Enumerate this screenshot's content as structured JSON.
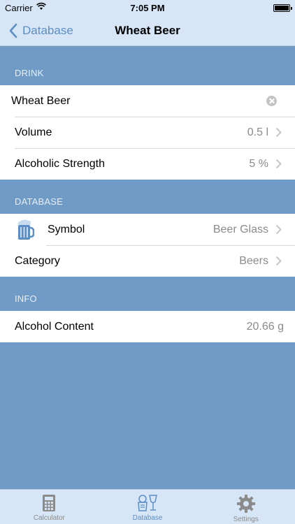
{
  "status_bar": {
    "carrier": "Carrier",
    "time": "7:05 PM"
  },
  "nav": {
    "back_label": "Database",
    "title": "Wheat Beer"
  },
  "sections": {
    "drink": {
      "header": "DRINK",
      "name_value": "Wheat Beer",
      "rows": [
        {
          "label": "Volume",
          "value": "0.5 l"
        },
        {
          "label": "Alcoholic Strength",
          "value": "5 %"
        }
      ]
    },
    "database": {
      "header": "DATABASE",
      "rows": [
        {
          "label": "Symbol",
          "value": "Beer Glass",
          "icon": "beer-mug-icon"
        },
        {
          "label": "Category",
          "value": "Beers"
        }
      ]
    },
    "info": {
      "header": "INFO",
      "rows": [
        {
          "label": "Alcohol Content",
          "value": "20.66 g"
        }
      ]
    }
  },
  "tabbar": {
    "tabs": [
      {
        "label": "Calculator",
        "icon": "calculator-icon"
      },
      {
        "label": "Database",
        "icon": "drinks-icon",
        "active": true
      },
      {
        "label": "Settings",
        "icon": "gear-icon"
      }
    ]
  },
  "colors": {
    "background": "#6f9bc6",
    "bar": "#d6e6f6",
    "accent": "#5d8ec3"
  }
}
